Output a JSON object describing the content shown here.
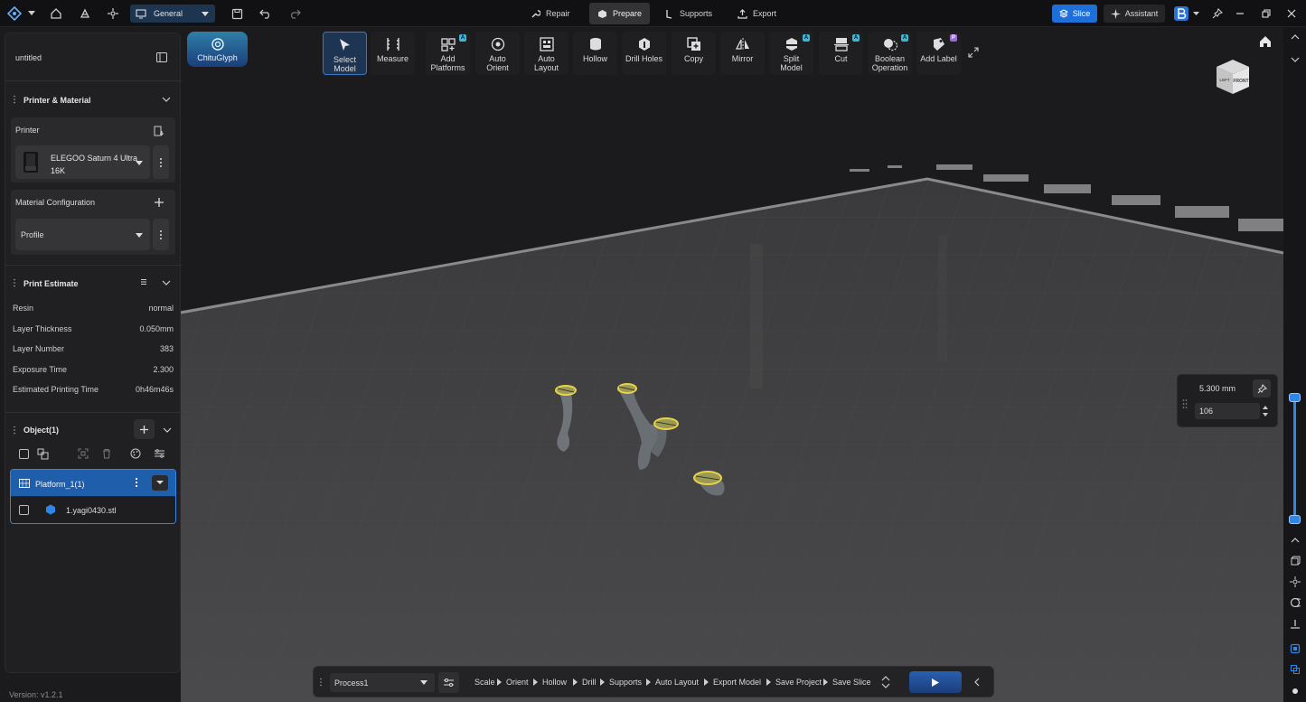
{
  "topbar": {
    "workspace": "General",
    "modes": [
      {
        "label": "Repair",
        "icon": "wrench-icon"
      },
      {
        "label": "Prepare",
        "icon": "cube-icon",
        "active": true
      },
      {
        "label": "Supports",
        "icon": "support-icon"
      },
      {
        "label": "Export",
        "icon": "export-icon"
      }
    ],
    "slice_label": "Slice",
    "assistant_label": "Assistant"
  },
  "left": {
    "project_title": "untitled",
    "printer_material": {
      "title": "Printer & Material",
      "printer_label": "Printer",
      "printer_name_line1": "ELEGOO Saturn 4 Ultra",
      "printer_name_line2": "16K",
      "material_label": "Material Configuration",
      "profile": "Profile"
    },
    "estimate": {
      "title": "Print Estimate",
      "rows": [
        {
          "label": "Resin",
          "value": "normal"
        },
        {
          "label": "Layer Thickness",
          "value": "0.050mm"
        },
        {
          "label": "Layer Number",
          "value": "383"
        },
        {
          "label": "Exposure Time",
          "value": "2.300"
        },
        {
          "label": "Estimated Printing Time",
          "value": "0h46m46s"
        }
      ]
    },
    "objects": {
      "title": "Object(1)",
      "platform": "Platform_1(1)",
      "file": "1.yagi0430.stl"
    },
    "version": "Version: v1.2.1"
  },
  "glyph_label": "ChituGlyph",
  "toolbar": [
    {
      "l1": "Select",
      "l2": "Model",
      "icon": "cursor-icon",
      "active": true
    },
    {
      "l1": "Measure",
      "l2": "",
      "icon": "ruler-icon"
    },
    {
      "l1": "Add",
      "l2": "Platforms",
      "icon": "add-platform-icon",
      "badge": "A"
    },
    {
      "l1": "Auto",
      "l2": "Orient",
      "icon": "orient-icon"
    },
    {
      "l1": "Auto",
      "l2": "Layout",
      "icon": "layout-icon"
    },
    {
      "l1": "Hollow",
      "l2": "",
      "icon": "hollow-icon"
    },
    {
      "l1": "Drill Holes",
      "l2": "",
      "icon": "drill-icon"
    },
    {
      "l1": "Copy",
      "l2": "",
      "icon": "copy-icon"
    },
    {
      "l1": "Mirror",
      "l2": "",
      "icon": "mirror-icon"
    },
    {
      "l1": "Split",
      "l2": "Model",
      "icon": "split-icon",
      "badge": "A"
    },
    {
      "l1": "Cut",
      "l2": "",
      "icon": "cut-icon",
      "badge": "A"
    },
    {
      "l1": "Boolean",
      "l2": "Operation",
      "icon": "boolean-icon",
      "badge": "A"
    },
    {
      "l1": "Add Label",
      "l2": "",
      "icon": "label-icon",
      "badge": "P"
    }
  ],
  "viewcube": {
    "front": "FRONT",
    "left": "LEFT"
  },
  "layer_panel": {
    "height": "5.300 mm",
    "layer": "106"
  },
  "bottombar": {
    "process": "Process1",
    "steps": [
      "Scale",
      "Orient",
      "Hollow",
      "Drill",
      "Supports",
      "Auto Layout",
      "Export Model",
      "Save Project",
      "Save Slice"
    ]
  }
}
